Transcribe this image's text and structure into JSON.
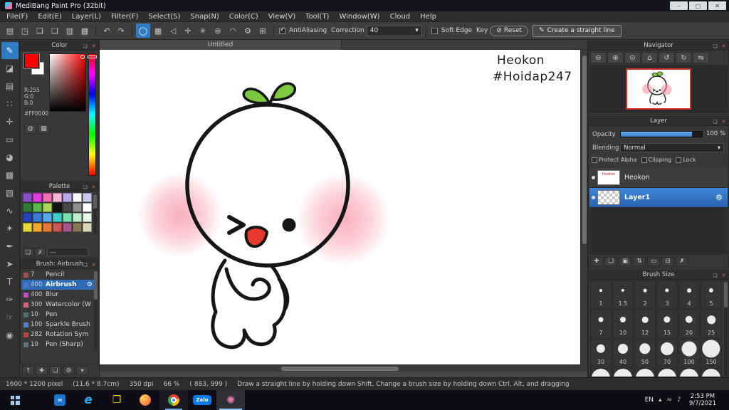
{
  "colors": {
    "accent": "#2f7cc4",
    "selection": "#2e6cb8",
    "nav-thumb-border": "#d03030",
    "leaf-green": "#7cc83e",
    "mouth-red": "#e8392e",
    "blush": "#f78ca0"
  },
  "window": {
    "title": "MediBang Paint Pro (32bit)",
    "minimize_glyph": "–",
    "maximize_glyph": "▢",
    "close_glyph": "✕"
  },
  "menubar": {
    "items": [
      "File(F)",
      "Edit(E)",
      "Layer(L)",
      "Filter(F)",
      "Select(S)",
      "Snap(N)",
      "Color(C)",
      "View(V)",
      "Tool(T)",
      "Window(W)",
      "Cloud",
      "Help"
    ]
  },
  "toolbar": {
    "file_icons": [
      {
        "name": "new-canvas-icon",
        "glyph": "▤"
      },
      {
        "name": "save-icon",
        "glyph": "◳"
      },
      {
        "name": "cloud-upload-icon",
        "glyph": "❑"
      },
      {
        "name": "comment-icon",
        "glyph": "❏"
      },
      {
        "name": "export-icon",
        "glyph": "▥"
      },
      {
        "name": "grid-view-icon",
        "glyph": "▦"
      }
    ],
    "undo_glyph": "↶",
    "redo_glyph": "↷",
    "brush_icons": [
      {
        "name": "brush-shape-circle-icon",
        "glyph": "◯",
        "selected": true
      },
      {
        "name": "pixel-grid-icon",
        "glyph": "▦"
      },
      {
        "name": "snap-off-icon",
        "glyph": "◁"
      },
      {
        "name": "snap-cross-icon",
        "glyph": "✛"
      },
      {
        "name": "snap-radial-icon",
        "glyph": "✳"
      },
      {
        "name": "snap-circle-icon",
        "glyph": "⊚"
      },
      {
        "name": "snap-curve-icon",
        "glyph": "◠"
      },
      {
        "name": "snap-settings-icon",
        "glyph": "⚙"
      },
      {
        "name": "snap-grid-icon",
        "glyph": "⊞"
      }
    ],
    "antialiasing_label": "AntiAliasing",
    "antialiasing_checked": true,
    "correction_label": "Correction",
    "correction_value": "40",
    "dropdown_arrow": "▾",
    "soft_edge_label": "Soft Edge",
    "key_label": "Key",
    "reset_glyph": "⊘",
    "reset_label": "Reset",
    "straight_line_glyph": "✎",
    "straight_line_label": "Create a straight line"
  },
  "toolstrip": {
    "tools": [
      {
        "name": "brush-tool",
        "glyph": "✎",
        "selected": true
      },
      {
        "name": "eraser-tool",
        "glyph": "◪"
      },
      {
        "name": "pen-tool",
        "glyph": "▤"
      },
      {
        "name": "dot-tool",
        "glyph": "∷"
      },
      {
        "name": "move-tool",
        "glyph": "✛"
      },
      {
        "name": "divide-tool",
        "glyph": "▭"
      },
      {
        "name": "bucket-tool",
        "glyph": "◕"
      },
      {
        "name": "gradient-tool",
        "glyph": "▩"
      },
      {
        "name": "select-tool",
        "glyph": "▧"
      },
      {
        "name": "lasso-tool",
        "glyph": "∿"
      },
      {
        "name": "magic-wand-tool",
        "glyph": "✶"
      },
      {
        "name": "select-pen-tool",
        "glyph": "✒"
      },
      {
        "name": "operation-tool",
        "glyph": "➤"
      },
      {
        "name": "text-tool",
        "glyph": "T"
      },
      {
        "name": "eyedropper-tool",
        "glyph": "✑"
      },
      {
        "name": "hand-tool",
        "glyph": "☞"
      },
      {
        "name": "zoom-tool",
        "glyph": "◉"
      }
    ]
  },
  "panels": {
    "header_popout_glyph": "❏",
    "header_close_glyph": "✕",
    "color": {
      "title": "Color",
      "r": "R:255",
      "g": "G:0",
      "b": "B:0",
      "hex": "#FF0000",
      "mode_icons": [
        {
          "name": "color-wheel-icon",
          "glyph": "◍"
        },
        {
          "name": "color-grid-icon",
          "glyph": "▦"
        }
      ]
    },
    "palette": {
      "title": "Palette",
      "swatches": [
        "#8a4fc8",
        "#e23ae2",
        "#f06eb4",
        "#f8b8d8",
        "#b8a8e8",
        "#f8f8f8",
        "#c8c8f0",
        "#2e7d32",
        "#58b847",
        "#a8d858",
        "#141414",
        "#484848",
        "#909090",
        "#ffffff",
        "#2244bb",
        "#3a7bd5",
        "#55aaee",
        "#44cccc",
        "#77ddaa",
        "#bbeecc",
        "#e8f8e8",
        "#e8d838",
        "#f0a830",
        "#e87838",
        "#c85858",
        "#a85888",
        "#887858",
        "#d8d8b8"
      ],
      "footer_icons": [
        {
          "name": "add-palette-color-icon",
          "glyph": "❏"
        },
        {
          "name": "delete-palette-color-icon",
          "glyph": "✗"
        }
      ],
      "footer_label": "---"
    },
    "brush": {
      "title": "Brush: Airbrush",
      "gear_glyph": "⚙",
      "items": [
        {
          "size": "7",
          "name": "Pencil",
          "chip": "#a05050"
        },
        {
          "size": "400",
          "name": "Airbrush",
          "chip": "#4a78c8",
          "selected": true
        },
        {
          "size": "400",
          "name": "Blur",
          "chip": "#c050c0"
        },
        {
          "size": "300",
          "name": "Watercolor (W",
          "chip": "#e06080"
        },
        {
          "size": "10",
          "name": "Pen",
          "chip": "#507070"
        },
        {
          "size": "100",
          "name": "Sparkle Brush",
          "chip": "#5080c0"
        },
        {
          "size": "282",
          "name": "Rotation Sym",
          "chip": "#c04040"
        },
        {
          "size": "10",
          "name": "Pen (Sharp)",
          "chip": "#607080"
        }
      ],
      "footer_icons": [
        {
          "name": "brush-up-icon",
          "glyph": "↑"
        },
        {
          "name": "add-brush-icon",
          "glyph": "✚"
        },
        {
          "name": "duplicate-brush-icon",
          "glyph": "❏"
        },
        {
          "name": "brush-settings-icon",
          "glyph": "⚙"
        },
        {
          "name": "brush-more-icon",
          "glyph": "▾"
        }
      ]
    },
    "navigator": {
      "title": "Navigator",
      "buttons": [
        {
          "name": "zoom-out-icon",
          "glyph": "⊖"
        },
        {
          "name": "zoom-in-icon",
          "glyph": "⊕"
        },
        {
          "name": "zoom-reset-icon",
          "glyph": "⊙"
        },
        {
          "name": "fit-window-icon",
          "glyph": "⌂"
        },
        {
          "name": "rotate-ccw-icon",
          "glyph": "↺"
        },
        {
          "name": "rotate-cw-icon",
          "glyph": "↻"
        },
        {
          "name": "flip-icon",
          "glyph": "⇋"
        }
      ]
    },
    "layer": {
      "title": "Layer",
      "gear_glyph": "⚙",
      "opacity_label": "Opacity",
      "opacity_value": "100 %",
      "blending_label": "Blending",
      "blending_value": "Normal",
      "dropdown_arrow": "▾",
      "checkboxes": [
        "Protect Alpha",
        "Clipping",
        "Lock"
      ],
      "layers": [
        {
          "name": "Heokon",
          "thumb": "sketch"
        },
        {
          "name": "Layer1",
          "thumb": "checker",
          "selected": true
        }
      ],
      "footer_icons": [
        {
          "name": "add-layer-icon",
          "glyph": "✚"
        },
        {
          "name": "duplicate-layer-icon",
          "glyph": "❏"
        },
        {
          "name": "add-folder-icon",
          "glyph": "▣"
        },
        {
          "name": "move-layer-icon",
          "glyph": "⇅"
        },
        {
          "name": "folder-icon",
          "glyph": "▭"
        },
        {
          "name": "merge-layer-icon",
          "glyph": "⊟"
        },
        {
          "name": "delete-layer-icon",
          "glyph": "✗"
        }
      ]
    },
    "brush_size": {
      "title": "Brush Size",
      "sizes": [
        "1",
        "1.5",
        "2",
        "3",
        "4",
        "5",
        "7",
        "10",
        "12",
        "15",
        "20",
        "25",
        "30",
        "40",
        "50",
        "70",
        "100",
        "150",
        "",
        "",
        "",
        "",
        "",
        ""
      ]
    }
  },
  "canvas": {
    "tab": "Untitled",
    "annotations": [
      "Heokon",
      "#Hoidap247"
    ]
  },
  "statusbar": {
    "size": "1600 * 1200 pixel",
    "dims": "(11.6 * 8.7cm)",
    "dpi": "350 dpi",
    "zoom": "66 %",
    "coords": "( 883, 999 )",
    "hint": "Draw a straight line by holding down Shift, Change a brush size by holding down Ctrl, Alt, and dragging"
  },
  "taskbar": {
    "items": [
      {
        "name": "taskbar-start-button"
      },
      {
        "name": "taskbar-icon-mail",
        "glyph": "✉"
      },
      {
        "name": "taskbar-icon-edge",
        "glyph": "e"
      },
      {
        "name": "taskbar-icon-explorer",
        "glyph": "❒"
      },
      {
        "name": "taskbar-icon-firefox"
      },
      {
        "name": "taskbar-icon-chrome",
        "open": true
      },
      {
        "name": "taskbar-icon-zalo",
        "label": "Zalo"
      },
      {
        "name": "taskbar-icon-medibang",
        "glyph": "✺",
        "active": true
      }
    ],
    "tray": {
      "language": "EN",
      "chevron_glyph": "▴",
      "network_glyph": "≈",
      "volume_glyph": "♪",
      "time": "2:53 PM",
      "date": "9/7/2021"
    }
  }
}
